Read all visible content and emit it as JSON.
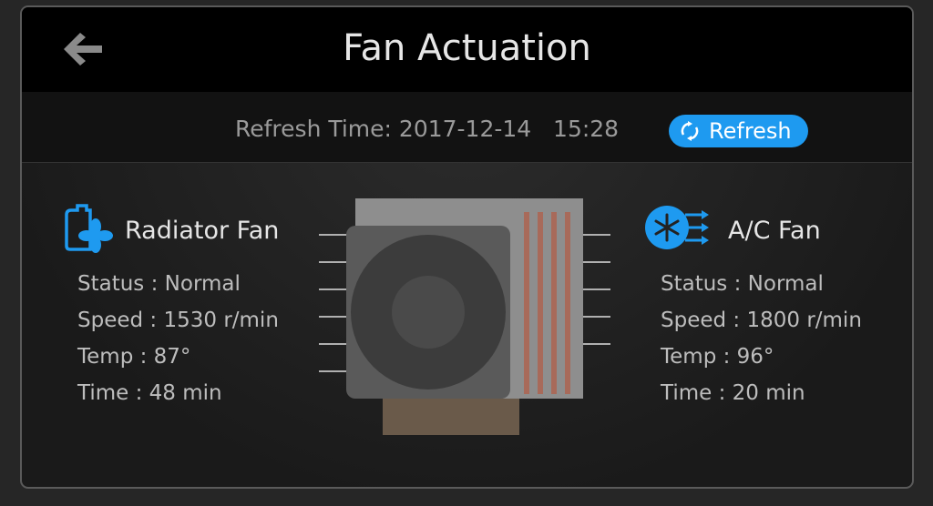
{
  "header": {
    "title": "Fan Actuation"
  },
  "refresh": {
    "time_text": "Refresh Time: 2017-12-14   15:28",
    "button_label": "Refresh"
  },
  "radiator": {
    "name": "Radiator Fan",
    "status": "Status :  Normal",
    "speed": "Speed :  1530 r/min",
    "temp": "Temp :  87°",
    "time": "Time :  48 min"
  },
  "ac": {
    "name": "A/C Fan",
    "status": "Status :  Normal",
    "speed": "Speed :  1800 r/min",
    "temp": "Temp :  96°",
    "time": "Time :  20 min"
  },
  "colors": {
    "accent": "#1e9af0"
  }
}
